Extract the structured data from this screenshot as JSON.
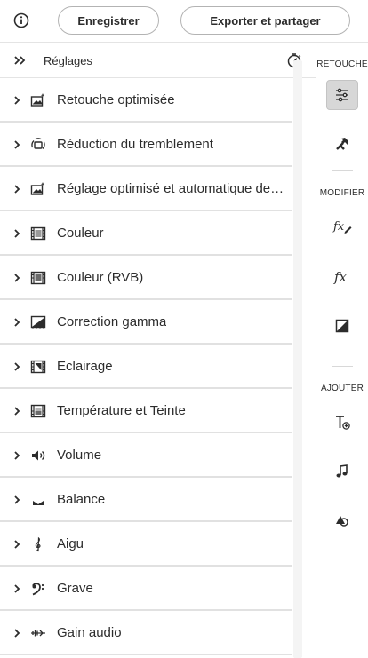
{
  "toolbar": {
    "info_icon": "info-icon",
    "save_label": "Enregistrer",
    "export_label": "Exporter et partager"
  },
  "panel": {
    "title": "Réglages",
    "items": [
      {
        "label": "Retouche optimisée",
        "icon": "magic-photo-icon"
      },
      {
        "label": "Réduction du tremblement",
        "icon": "stabilize-icon"
      },
      {
        "label": "Réglage optimisé et automatique des couleurs",
        "icon": "magic-photo-icon"
      },
      {
        "label": "Couleur",
        "icon": "film-icon"
      },
      {
        "label": "Couleur (RVB)",
        "icon": "film-icon"
      },
      {
        "label": "Correction gamma",
        "icon": "gamma-icon"
      },
      {
        "label": "Eclairage",
        "icon": "film-light-icon"
      },
      {
        "label": "Température et Teinte",
        "icon": "film-icon"
      },
      {
        "label": "Volume",
        "icon": "speaker-icon"
      },
      {
        "label": "Balance",
        "icon": "balance-icon"
      },
      {
        "label": "Aigu",
        "icon": "treble-clef-icon"
      },
      {
        "label": "Grave",
        "icon": "bass-clef-icon"
      },
      {
        "label": "Gain audio",
        "icon": "audio-gain-icon"
      }
    ]
  },
  "rail": {
    "sections": {
      "retouche": "RETOUCHE",
      "modifier": "MODIFIER",
      "ajouter": "AJOUTER"
    },
    "buttons": [
      {
        "name": "adjustments-icon",
        "active": true
      },
      {
        "name": "tools-icon",
        "active": false
      },
      {
        "name": "fx-edit-icon",
        "active": false
      },
      {
        "name": "fx-icon",
        "active": false
      },
      {
        "name": "contrast-icon",
        "active": false
      },
      {
        "name": "text-add-icon",
        "active": false
      },
      {
        "name": "music-note-icon",
        "active": false
      },
      {
        "name": "shapes-icon",
        "active": false
      }
    ]
  },
  "colors": {
    "text": "#2c2c2c",
    "divider": "#e1e1e1",
    "active_bg": "#d7d7d7"
  }
}
